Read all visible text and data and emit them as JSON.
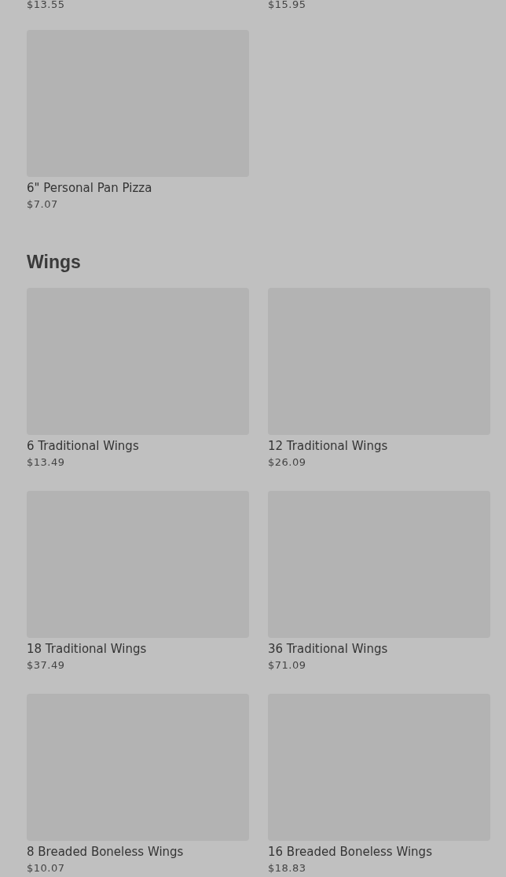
{
  "sections": [
    {
      "items": [
        {
          "kind": "price-only",
          "price": "$13.55"
        },
        {
          "kind": "price-only",
          "price": "$15.95"
        },
        {
          "kind": "card",
          "name": "6\" Personal Pan Pizza",
          "price": "$7.07"
        }
      ]
    },
    {
      "title": "Wings",
      "items": [
        {
          "kind": "card",
          "name": "6 Traditional Wings",
          "price": "$13.49"
        },
        {
          "kind": "card",
          "name": "12 Traditional Wings",
          "price": "$26.09"
        },
        {
          "kind": "card",
          "name": "18 Traditional Wings",
          "price": "$37.49"
        },
        {
          "kind": "card",
          "name": "36 Traditional Wings",
          "price": "$71.09"
        },
        {
          "kind": "card",
          "name": "8 Breaded Boneless Wings",
          "price": "$10.07"
        },
        {
          "kind": "card",
          "name": "16 Breaded Boneless Wings",
          "price": "$18.83"
        }
      ]
    }
  ]
}
